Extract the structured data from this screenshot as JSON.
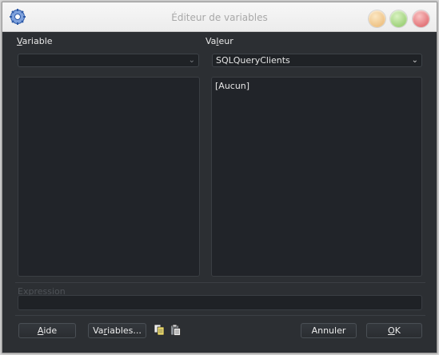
{
  "window": {
    "title": "Éditeur de variables"
  },
  "variable": {
    "label": "Variable",
    "accel": "V",
    "rest": "ariable",
    "combo_value": ""
  },
  "valeur": {
    "label": "Valeur",
    "accel_pre": "Va",
    "accel": "l",
    "rest": "eur",
    "combo_value": "SQLQueryClients",
    "content": "[Aucun]"
  },
  "expression": {
    "label": "Expression",
    "value": ""
  },
  "buttons": {
    "aide": {
      "accel": "A",
      "rest": "ide"
    },
    "variables": {
      "pre": "Va",
      "accel": "r",
      "rest": "iables..."
    },
    "annuler": {
      "label": "Annuler"
    },
    "ok": {
      "accel": "O",
      "rest": "K"
    }
  },
  "icons": [
    "app-gear-icon",
    "chevron-down-icon",
    "copy-icon",
    "paste-icon"
  ]
}
